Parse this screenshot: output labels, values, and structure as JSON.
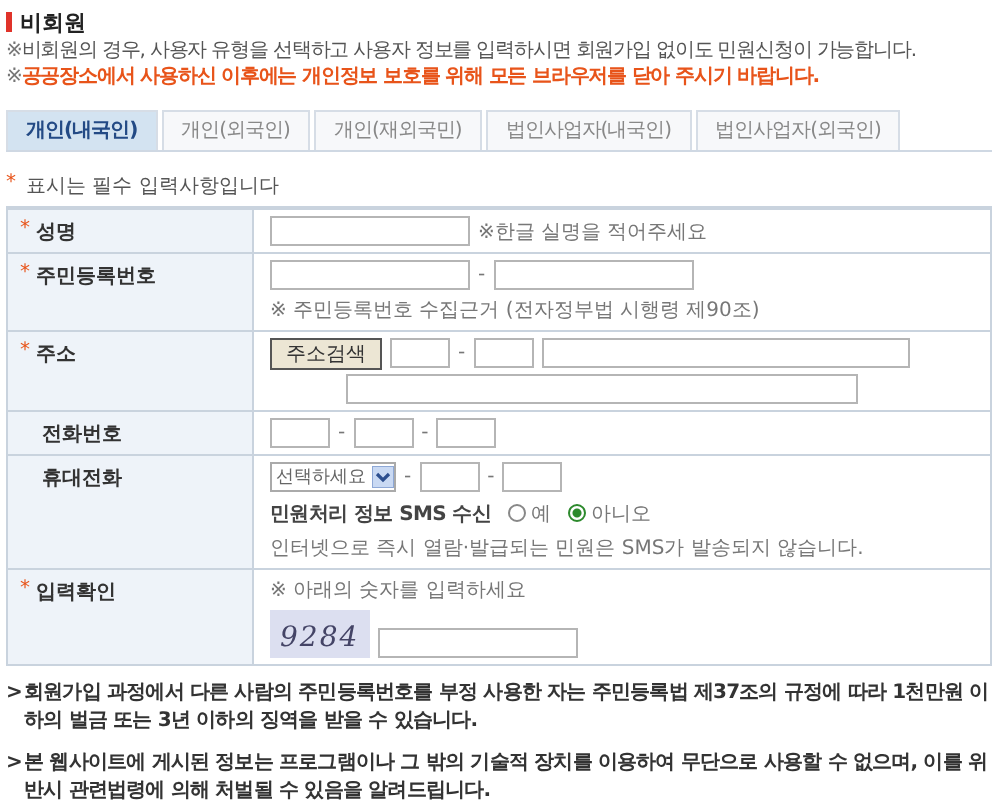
{
  "section_title": "비회원",
  "notices": [
    {
      "mark": "※",
      "text": "비회원의 경우, 사용자 유형을 선택하고 사용자 정보를 입력하시면 회원가입 없이도 민원신청이 가능합니다.",
      "kind": "info"
    },
    {
      "mark": "※",
      "text": "공공장소에서 사용하신 이후에는 개인정보 보호를 위해 모든 브라우저를 닫아 주시기 바랍니다.",
      "kind": "warning"
    }
  ],
  "tabs": [
    {
      "label": "개인(내국인)",
      "selected": true
    },
    {
      "label": "개인(외국인)",
      "selected": false
    },
    {
      "label": "개인(재외국민)",
      "selected": false
    },
    {
      "label": "법인사업자(내국인)",
      "selected": false
    },
    {
      "label": "법인사업자(외국인)",
      "selected": false
    }
  ],
  "required_note": {
    "mark": "*",
    "text": "표시는 필수 입력사항입니다"
  },
  "rows": [
    {
      "kind": "name",
      "label": "성명",
      "required": true,
      "hint": "※한글 실명을 적어주세요"
    },
    {
      "kind": "rrn",
      "label": "주민등록번호",
      "required": true,
      "separator": "-",
      "note": "※ 주민등록번호 수집근거 (전자정부법 시행령 제90조)"
    },
    {
      "kind": "address",
      "label": "주소",
      "required": true,
      "button": "주소검색",
      "separator": "-"
    },
    {
      "kind": "phone",
      "label": "전화번호",
      "required": false,
      "separators": [
        "-",
        "-"
      ]
    },
    {
      "kind": "mobile",
      "label": "휴대전화",
      "required": false,
      "select": "선택하세요",
      "separators": [
        "-",
        "-"
      ],
      "sms_label": "민원처리 정보 SMS 수신",
      "options": [
        {
          "label": "예",
          "selected": false
        },
        {
          "label": "아니오",
          "selected": true
        }
      ],
      "note": "인터넷으로 즉시 열람·발급되는 민원은 SMS가 발송되지 않습니다."
    },
    {
      "kind": "captcha",
      "label": "입력확인",
      "required": true,
      "hint": "※ 아래의 숫자를 입력하세요",
      "code": "9284"
    }
  ],
  "footer_notes": [
    {
      "mark": ">",
      "text": "회원가입 과정에서 다른 사람의 주민등록번호를 부정 사용한 자는 주민등록법 제37조의 규정에 따라 1천만원 이하의 벌금 또는 3년 이하의 징역을 받을 수 있습니다."
    },
    {
      "mark": ">",
      "text": "본 웹사이트에 게시된 정보는 프로그램이나 그 밖의 기술적 장치를 이용하여 무단으로 사용할 수 없으며, 이를 위반시 관련법령에 의해 처벌될 수 있음을 알려드립니다."
    }
  ]
}
